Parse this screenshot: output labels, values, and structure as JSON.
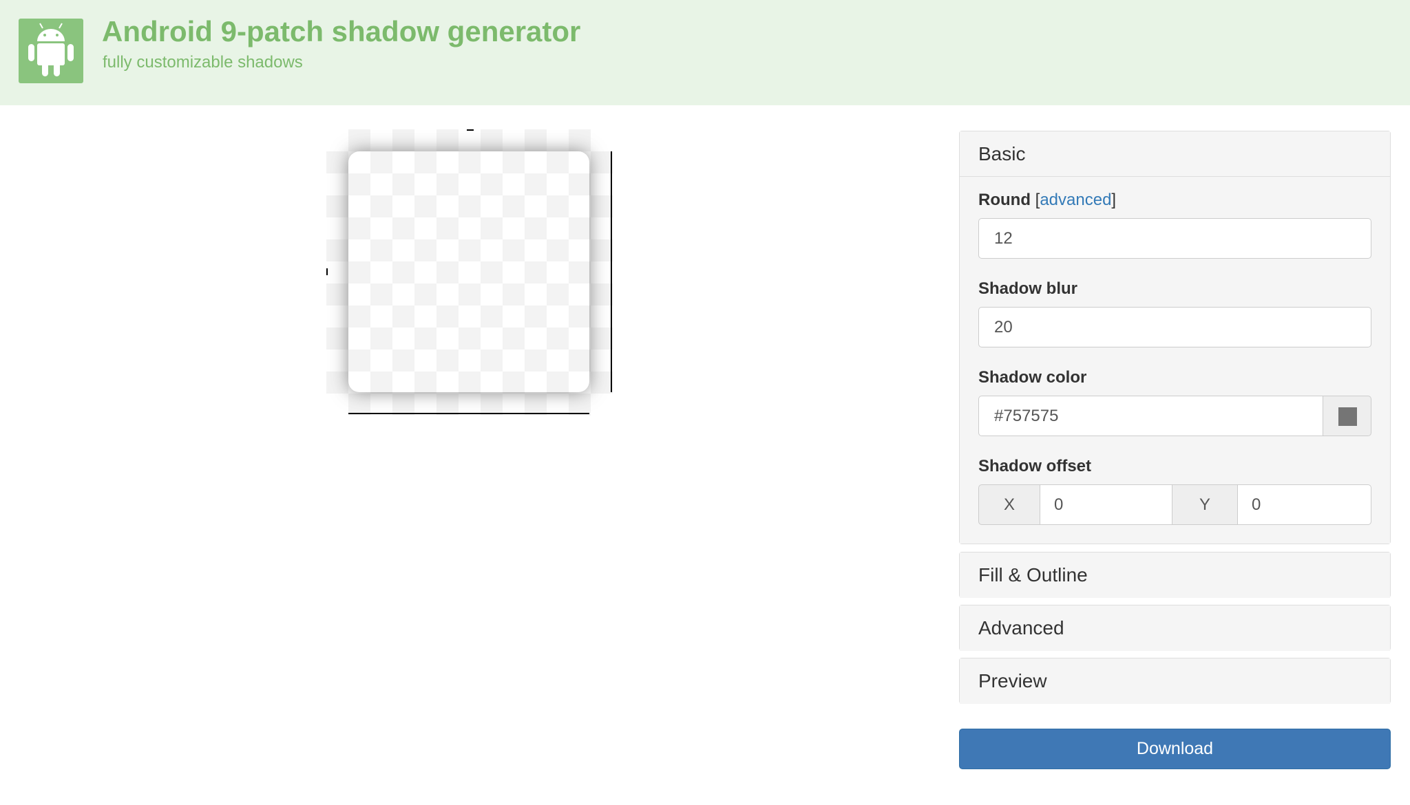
{
  "header": {
    "title": "Android 9-patch shadow generator",
    "subtitle": "fully customizable shadows",
    "logo_icon": "android-robot-icon"
  },
  "sidebar": {
    "basic": {
      "heading": "Basic",
      "round": {
        "label": "Round",
        "bracket_open": "[",
        "link": "advanced",
        "bracket_close": "]",
        "value": "12"
      },
      "shadow_blur": {
        "label": "Shadow blur",
        "value": "20"
      },
      "shadow_color": {
        "label": "Shadow color",
        "value": "#757575",
        "swatch_color": "#757575"
      },
      "shadow_offset": {
        "label": "Shadow offset",
        "x_label": "X",
        "x_value": "0",
        "y_label": "Y",
        "y_value": "0"
      }
    },
    "fill_outline": {
      "heading": "Fill & Outline"
    },
    "advanced": {
      "heading": "Advanced"
    },
    "preview": {
      "heading": "Preview"
    },
    "download_label": "Download"
  },
  "colors": {
    "header_bg": "#e8f4e6",
    "brand_green": "#7cba6c",
    "button_blue": "#3f78b5"
  }
}
